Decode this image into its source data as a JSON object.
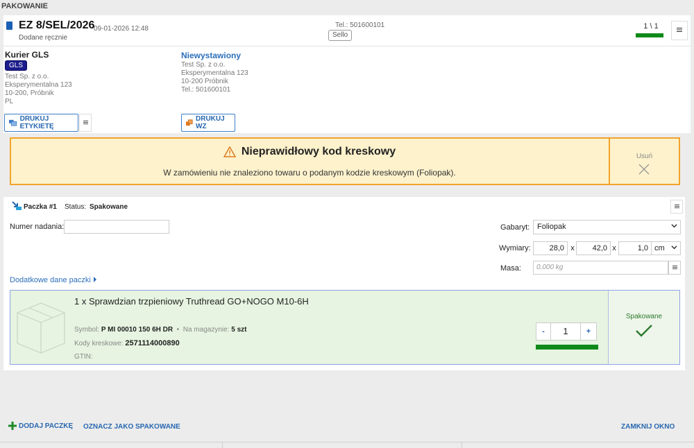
{
  "page": {
    "title": "PAKOWANIE"
  },
  "order": {
    "number": "EZ 8/SEL/2026",
    "date": "09-01-2026 12:48",
    "source": "Dodane ręcznie",
    "phone": "Tel.: 501600101",
    "channel_badge": "Sello",
    "progress_text": "1 \\ 1",
    "progress_fraction": 1.0,
    "menu_icon": "menu-icon"
  },
  "sender": {
    "courier": "Kurier GLS",
    "badge": "GLS",
    "lines": [
      "Test Sp. z o.o.",
      "Eksperymentalna 123",
      "10-200, Próbnik",
      "PL"
    ],
    "print_label_button": "DRUKUJ ETYKIETĘ"
  },
  "receiver": {
    "status": "Niewystawiony",
    "lines": [
      "Test Sp. z o.o.",
      "Eksperymentalna 123",
      "10-200 Próbnik",
      "Tel.:  501600101"
    ],
    "print_wz_button": "DRUKUJ WZ"
  },
  "alert": {
    "title": "Nieprawidłowy kod kreskowy",
    "message": "W zamówieniu nie znaleziono towaru o podanym kodzie kreskowym (Foliopak).",
    "remove_label": "Usuń",
    "color": "#f2a32b"
  },
  "package": {
    "title": "Paczka #1",
    "status_label": "Status:",
    "status_value": "Spakowane",
    "tracking_label": "Numer nadania:",
    "tracking_value": "",
    "size_label": "Gabaryt:",
    "size_value": "Foliopak",
    "dims_label": "Wymiary:",
    "dims": [
      "28,0",
      "42,0",
      "1,0"
    ],
    "dims_sep": "x",
    "dims_unit": "cm",
    "mass_label": "Masa:",
    "mass_placeholder": "0,000 kg",
    "extra_link": "Dodatkowe dane paczki"
  },
  "item": {
    "title": "1 x Sprawdzian trzpieniowy Truthread GO+NOGO M10-6H",
    "symbol_label": "Symbol:",
    "symbol_value": "P MI 00010 150 6H DR",
    "stock_label": "Na magazynie:",
    "stock_value": "5 szt",
    "barcode_label": "Kody kreskowe:",
    "barcode_value": "2571114000890",
    "gtin_label": "GTIN:",
    "gtin_value": "",
    "quantity": "1",
    "minus": "-",
    "plus": "+",
    "packed_fraction": 1.0,
    "status": "Spakowane"
  },
  "footer": {
    "add_package": "DODAJ PACZKĘ",
    "mark_packed": "OZNACZ JAKO SPAKOWANE",
    "close_window": "ZAMKNIJ OKNO"
  },
  "colors": {
    "accent": "#2767b0",
    "progress": "#0f8a1a",
    "item_bg": "#e6f4e1"
  }
}
